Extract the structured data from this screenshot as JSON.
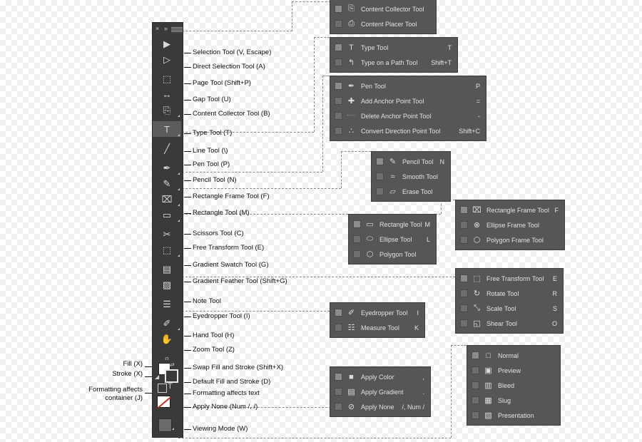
{
  "toolbar": {
    "title_close": "×",
    "title_arrows": "»",
    "tools": [
      {
        "name": "selection-tool",
        "glyph": "▶",
        "label": "Selection Tool  (V, Escape)",
        "selected": false,
        "flyout": false
      },
      {
        "name": "direct-selection-tool",
        "glyph": "▷",
        "label": "Direct Selection Tool  (A)",
        "selected": false,
        "flyout": false
      },
      {
        "name": "page-tool",
        "glyph": "⬚",
        "label": "Page Tool (Shift+P)",
        "selected": false,
        "flyout": false
      },
      {
        "name": "gap-tool",
        "glyph": "↔",
        "label": "Gap Tool (U)",
        "selected": false,
        "flyout": false
      },
      {
        "name": "content-collector-tool",
        "glyph": "⎘",
        "label": "Content Collector Tool (B)",
        "selected": false,
        "flyout": true
      },
      {
        "name": "type-tool",
        "glyph": "T",
        "label": "Type Tool (T)",
        "selected": true,
        "flyout": true
      },
      {
        "name": "line-tool",
        "glyph": "╱",
        "label": "Line Tool (\\)",
        "selected": false,
        "flyout": false
      },
      {
        "name": "pen-tool",
        "glyph": "✒",
        "label": "Pen Tool (P)",
        "selected": false,
        "flyout": true
      },
      {
        "name": "pencil-tool",
        "glyph": "✎",
        "label": "Pencil Tool (N)",
        "selected": false,
        "flyout": true
      },
      {
        "name": "rectangle-frame-tool",
        "glyph": "⌧",
        "label": "Rectangle Frame Tool (F)",
        "selected": false,
        "flyout": true
      },
      {
        "name": "rectangle-tool",
        "glyph": "▭",
        "label": "Rectangle Tool (M)",
        "selected": false,
        "flyout": true
      },
      {
        "name": "scissors-tool",
        "glyph": "✂",
        "label": "Scissors Tool (C)",
        "selected": false,
        "flyout": false
      },
      {
        "name": "free-transform-tool",
        "glyph": "⬚",
        "label": "Free Transform Tool (E)",
        "selected": false,
        "flyout": true
      },
      {
        "name": "gradient-swatch-tool",
        "glyph": "▤",
        "label": "Gradient Swatch Tool (G)",
        "selected": false,
        "flyout": false
      },
      {
        "name": "gradient-feather-tool",
        "glyph": "▨",
        "label": "Gradient Feather Tool (Shift+G)",
        "selected": false,
        "flyout": false
      },
      {
        "name": "note-tool",
        "glyph": "☰",
        "label": "Note Tool",
        "selected": false,
        "flyout": false
      },
      {
        "name": "eyedropper-tool",
        "glyph": "✐",
        "label": "Eyedropper Tool (I)",
        "selected": false,
        "flyout": true
      },
      {
        "name": "hand-tool",
        "glyph": "✋",
        "label": "Hand Tool (H)",
        "selected": false,
        "flyout": false
      },
      {
        "name": "zoom-tool",
        "glyph": "⌕",
        "label": "Zoom Tool (Z)",
        "selected": false,
        "flyout": false
      }
    ],
    "fill_stroke": {
      "fill_label": "Fill (X)",
      "stroke_label": "Stroke (X)",
      "swap_label": "Swap Fill and Stroke (Shift+X)",
      "default_label": "Default Fill and Stroke (D)",
      "formatting_text_label": "Formatting affects text",
      "formatting_container_label": "Formatting affects\ncontainer (J)",
      "formatting_container_line1": "Formatting affects",
      "formatting_container_line2": "container (J)",
      "apply_none_label": "Apply None (Num /, /)",
      "viewing_mode_label": "Viewing Mode (W)"
    }
  },
  "flyouts": [
    {
      "name": "content-collector-flyout",
      "items": [
        {
          "icon": "⎘",
          "label": "Content Collector Tool",
          "key": ""
        },
        {
          "icon": "⎙",
          "label": "Content Placer Tool",
          "key": ""
        }
      ]
    },
    {
      "name": "type-flyout",
      "items": [
        {
          "icon": "T",
          "label": "Type Tool",
          "key": "T"
        },
        {
          "icon": "↰",
          "label": "Type on a Path Tool",
          "key": "Shift+T"
        }
      ]
    },
    {
      "name": "pen-flyout",
      "items": [
        {
          "icon": "✒",
          "label": "Pen Tool",
          "key": "P"
        },
        {
          "icon": "✚",
          "label": "Add Anchor Point Tool",
          "key": "="
        },
        {
          "icon": "➖",
          "label": "Delete Anchor Point Tool",
          "key": "-"
        },
        {
          "icon": "∴",
          "label": "Convert Direction Point Tool",
          "key": "Shift+C"
        }
      ]
    },
    {
      "name": "pencil-flyout",
      "items": [
        {
          "icon": "✎",
          "label": "Pencil Tool",
          "key": "N"
        },
        {
          "icon": "≈",
          "label": "Smooth Tool",
          "key": ""
        },
        {
          "icon": "▱",
          "label": "Erase Tool",
          "key": ""
        }
      ]
    },
    {
      "name": "rectangle-flyout",
      "items": [
        {
          "icon": "▭",
          "label": "Rectangle Tool",
          "key": "M"
        },
        {
          "icon": "⬭",
          "label": "Ellipse Tool",
          "key": "L"
        },
        {
          "icon": "⬡",
          "label": "Polygon Tool",
          "key": ""
        }
      ]
    },
    {
      "name": "frame-flyout",
      "items": [
        {
          "icon": "⌧",
          "label": "Rectangle Frame Tool",
          "key": "F"
        },
        {
          "icon": "⊗",
          "label": "Ellipse Frame Tool",
          "key": ""
        },
        {
          "icon": "⬡",
          "label": "Polygon Frame Tool",
          "key": ""
        }
      ]
    },
    {
      "name": "transform-flyout",
      "items": [
        {
          "icon": "⬚",
          "label": "Free Transform Tool",
          "key": "E"
        },
        {
          "icon": "↻",
          "label": "Rotate Tool",
          "key": "R"
        },
        {
          "icon": "⤡",
          "label": "Scale Tool",
          "key": "S"
        },
        {
          "icon": "◱",
          "label": "Shear Tool",
          "key": "O"
        }
      ]
    },
    {
      "name": "eyedropper-flyout",
      "items": [
        {
          "icon": "✐",
          "label": "Eyedropper Tool",
          "key": "I"
        },
        {
          "icon": "☷",
          "label": "Measure Tool",
          "key": "K"
        }
      ]
    },
    {
      "name": "apply-flyout",
      "items": [
        {
          "icon": "■",
          "label": "Apply Color",
          "key": ","
        },
        {
          "icon": "▤",
          "label": "Apply Gradient",
          "key": "."
        },
        {
          "icon": "⊘",
          "label": "Apply None",
          "key": "/, Num /"
        }
      ]
    },
    {
      "name": "viewing-mode-flyout",
      "items": [
        {
          "icon": "□",
          "label": "Normal",
          "key": ""
        },
        {
          "icon": "▣",
          "label": "Preview",
          "key": ""
        },
        {
          "icon": "▥",
          "label": "Bleed",
          "key": ""
        },
        {
          "icon": "▦",
          "label": "Slug",
          "key": ""
        },
        {
          "icon": "▨",
          "label": "Presentation",
          "key": ""
        }
      ]
    }
  ],
  "colors": {
    "panel_bg": "#3a3a3a",
    "flyout_bg": "#565656",
    "selected_bg": "#5c5c5c",
    "text_light": "#e2e2e2",
    "text_dark": "#111111",
    "accent_red": "#b33a2e"
  }
}
